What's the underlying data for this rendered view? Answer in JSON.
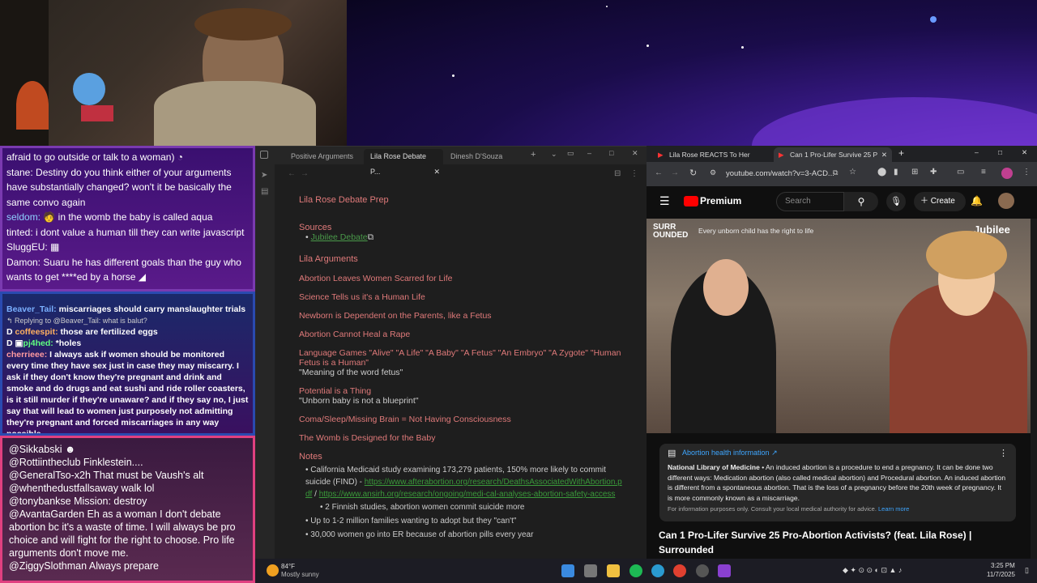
{
  "chat1": {
    "lines": [
      {
        "user": "",
        "text": "afraid to go outside or talk to a woman)"
      },
      {
        "user": "stane:",
        "text": " Destiny do you think either of your arguments have substantially changed? won't it be basically the same convo again"
      },
      {
        "user": "seldom:",
        "text": " in the womb the baby is called aqua"
      },
      {
        "user": "tinted:",
        "text": " i dont value a human till they can write javascript"
      },
      {
        "user": "SluggEU:",
        "text": ""
      },
      {
        "user": "Damon:",
        "text": " Suaru he has different goals than the guy who wants to get ****ed by a horse"
      }
    ]
  },
  "chat2": {
    "reply1": "Replying to @Beaver_Tail: what is balut?",
    "l1user": "Beaver_Tail:",
    "l1": " miscarriages should carry manslaughter trials",
    "l2user": "coffeespit:",
    "l2": " those are fertilized eggs",
    "l3user": "pj4hed:",
    "l3": " *holes",
    "l4user": "cherrieee:",
    "l4": " I always ask if women should be monitored every time they have sex just in case they may miscarry. I ask if they don't know they're pregnant and drink and smoke and do drugs and eat sushi and ride roller coasters, is it still murder if they're unaware? and if they say no, I just say that will lead to women just purposely not admitting they're pregnant and forced miscarriages in any way possible"
  },
  "chat3": {
    "lines": [
      {
        "user": "@Sikkabski",
        "text": ""
      },
      {
        "user": "@Rottiintheclub",
        "text": " Finklestein...."
      },
      {
        "user": "@GeneralTso-x2h",
        "text": " That must be Vaush's alt"
      },
      {
        "user": "@whenthedustfallsaway",
        "text": " walk lol"
      },
      {
        "user": "@tonybankse",
        "text": " Mission: destroy"
      },
      {
        "user": "@AvantaGarden",
        "text": " Eh as a woman I don't debate abortion bc it's a waste of time. I will always be pro choice and will fight for the right to choose. Pro life arguments don't move me."
      },
      {
        "user": "@ZiggySlothman",
        "text": " Always prepare"
      }
    ]
  },
  "obsidian": {
    "tabs": [
      "Positive Arguments",
      "Lila Rose Debate P...",
      "Dinesh D'Souza"
    ],
    "title": "Lila Rose Debate Prep",
    "sources_h": "Sources",
    "source_link": "Jubilee Debate",
    "args_h": "Lila Arguments",
    "args": [
      "Abortion Leaves Women Scarred for Life",
      "Science Tells us it's a Human Life",
      "Newborn is Dependent on the Parents, like a Fetus",
      "Abortion Cannot Heal a Rape"
    ],
    "lang_h": "Language Games \"Alive\" \"A Life\" \"A Baby\" \"A Fetus\" \"An Embryo\" \"A Zygote\" \"Human Fetus is a Human\"",
    "lang_sub": "\"Meaning of the word fetus\"",
    "pot_h": "Potential is a Thing",
    "pot_sub": "\"Unborn baby is not a blueprint\"",
    "coma_h": "Coma/Sleep/Missing Brain = Not Having Consciousness",
    "womb_h": "The Womb is Designed for the Baby",
    "notes_h": "Notes",
    "note1": "California Medicaid study examining 173,279 patients, 150% more likely to commit suicide (FIND) - ",
    "note1_l1": "https://www.afterabortion.org/research/DeathsAssociatedWithAbortion.pdf",
    "note1_sep": " / ",
    "note1_l2": "https://www.ansirh.org/research/ongoing/medi-cal-analyses-abortion-safety-access",
    "note2": "2 Finnish studies, abortion women commit suicide more",
    "note3": "Up to 1-2 million families wanting to adopt but they \"can't\"",
    "note4": "30,000 women go into ER because of abortion pills every year"
  },
  "browser": {
    "tabs": [
      "Lila Rose REACTS To Her Jubilee",
      "Can 1 Pro-Lifer Survive 25 P"
    ],
    "url": "youtube.com/watch?v=3-ACD...",
    "premium": "Premium",
    "search_ph": "Search",
    "create": "Create",
    "video_brand": "SURR\nOUNDED",
    "video_caption": "Every unborn child has the right to life",
    "video_logo": "Jubilee",
    "info_title": "Abortion health information",
    "info_src": "National Library of Medicine",
    "info_body": " • An induced abortion is a procedure to end a pregnancy. It can be done two different ways: Medication abortion (also called medical abortion) and Procedural abortion. An induced abortion is different from a spontaneous abortion. That is the loss of a pregnancy before the 20th week of pregnancy. It is more commonly known as a miscarriage.",
    "info_foot": "For information purposes only. Consult your local medical authority for advice.",
    "info_learn": "Learn more",
    "title": "Can 1 Pro-Lifer Survive 25 Pro-Abortion Activists? (feat. Lila Rose) | Surrounded"
  },
  "taskbar": {
    "temp": "84°F",
    "weather": "Mostly sunny",
    "time": "3:25 PM",
    "date": "11/7/2025"
  }
}
